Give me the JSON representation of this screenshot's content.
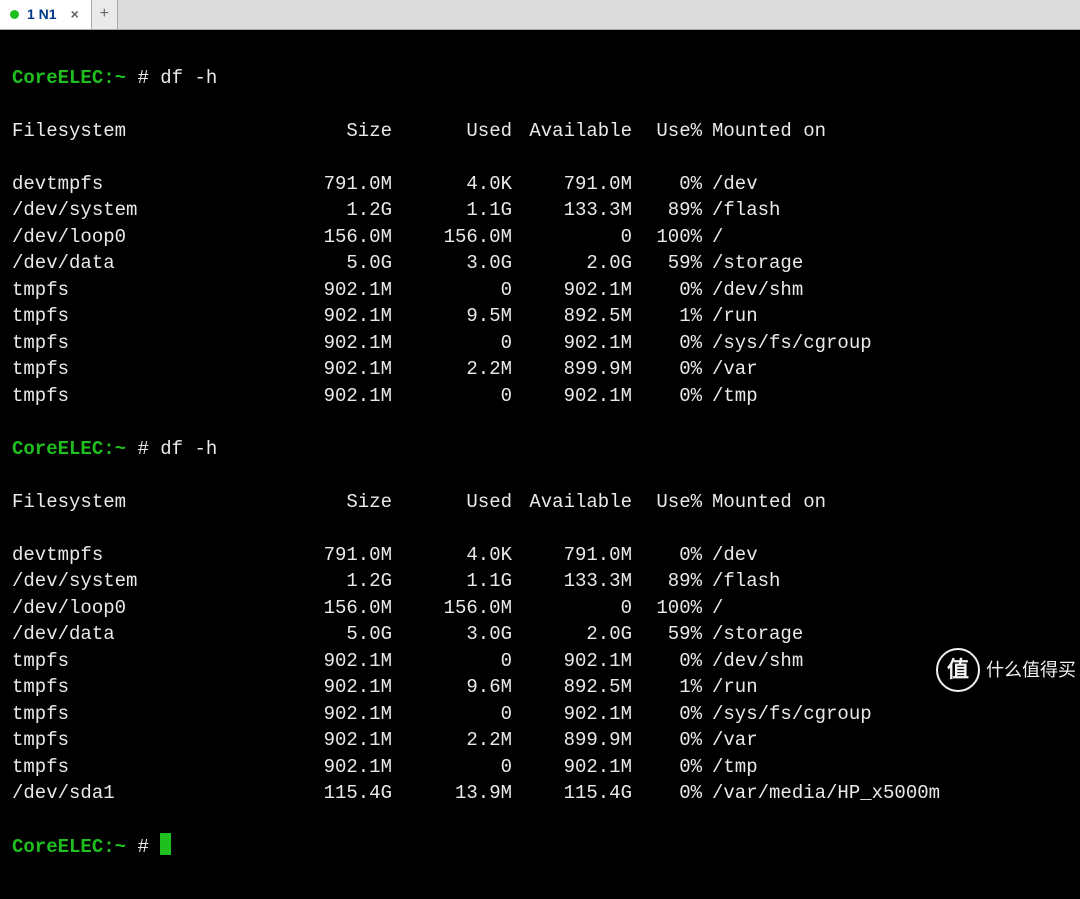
{
  "tab": {
    "title": "1 N1",
    "close": "×",
    "plus": "+"
  },
  "prompt": {
    "host": "CoreELEC:",
    "tilde": "~",
    "hash": "#"
  },
  "cmd": "df -h",
  "headers": {
    "fs": "Filesystem",
    "size": "Size",
    "used": "Used",
    "avail": "Available",
    "usep": "Use%",
    "mnt": "Mounted on"
  },
  "table1": [
    {
      "fs": "devtmpfs",
      "size": "791.0M",
      "used": "4.0K",
      "avail": "791.0M",
      "usep": "0%",
      "mnt": "/dev"
    },
    {
      "fs": "/dev/system",
      "size": "1.2G",
      "used": "1.1G",
      "avail": "133.3M",
      "usep": "89%",
      "mnt": "/flash"
    },
    {
      "fs": "/dev/loop0",
      "size": "156.0M",
      "used": "156.0M",
      "avail": "0",
      "usep": "100%",
      "mnt": "/"
    },
    {
      "fs": "/dev/data",
      "size": "5.0G",
      "used": "3.0G",
      "avail": "2.0G",
      "usep": "59%",
      "mnt": "/storage"
    },
    {
      "fs": "tmpfs",
      "size": "902.1M",
      "used": "0",
      "avail": "902.1M",
      "usep": "0%",
      "mnt": "/dev/shm"
    },
    {
      "fs": "tmpfs",
      "size": "902.1M",
      "used": "9.5M",
      "avail": "892.5M",
      "usep": "1%",
      "mnt": "/run"
    },
    {
      "fs": "tmpfs",
      "size": "902.1M",
      "used": "0",
      "avail": "902.1M",
      "usep": "0%",
      "mnt": "/sys/fs/cgroup"
    },
    {
      "fs": "tmpfs",
      "size": "902.1M",
      "used": "2.2M",
      "avail": "899.9M",
      "usep": "0%",
      "mnt": "/var"
    },
    {
      "fs": "tmpfs",
      "size": "902.1M",
      "used": "0",
      "avail": "902.1M",
      "usep": "0%",
      "mnt": "/tmp"
    }
  ],
  "table2": [
    {
      "fs": "devtmpfs",
      "size": "791.0M",
      "used": "4.0K",
      "avail": "791.0M",
      "usep": "0%",
      "mnt": "/dev"
    },
    {
      "fs": "/dev/system",
      "size": "1.2G",
      "used": "1.1G",
      "avail": "133.3M",
      "usep": "89%",
      "mnt": "/flash"
    },
    {
      "fs": "/dev/loop0",
      "size": "156.0M",
      "used": "156.0M",
      "avail": "0",
      "usep": "100%",
      "mnt": "/"
    },
    {
      "fs": "/dev/data",
      "size": "5.0G",
      "used": "3.0G",
      "avail": "2.0G",
      "usep": "59%",
      "mnt": "/storage"
    },
    {
      "fs": "tmpfs",
      "size": "902.1M",
      "used": "0",
      "avail": "902.1M",
      "usep": "0%",
      "mnt": "/dev/shm"
    },
    {
      "fs": "tmpfs",
      "size": "902.1M",
      "used": "9.6M",
      "avail": "892.5M",
      "usep": "1%",
      "mnt": "/run"
    },
    {
      "fs": "tmpfs",
      "size": "902.1M",
      "used": "0",
      "avail": "902.1M",
      "usep": "0%",
      "mnt": "/sys/fs/cgroup"
    },
    {
      "fs": "tmpfs",
      "size": "902.1M",
      "used": "2.2M",
      "avail": "899.9M",
      "usep": "0%",
      "mnt": "/var"
    },
    {
      "fs": "tmpfs",
      "size": "902.1M",
      "used": "0",
      "avail": "902.1M",
      "usep": "0%",
      "mnt": "/tmp"
    },
    {
      "fs": "/dev/sda1",
      "size": "115.4G",
      "used": "13.9M",
      "avail": "115.4G",
      "usep": "0%",
      "mnt": "/var/media/HP_x5000m"
    }
  ],
  "watermark": {
    "badge": "值",
    "text": "什么值得买"
  }
}
